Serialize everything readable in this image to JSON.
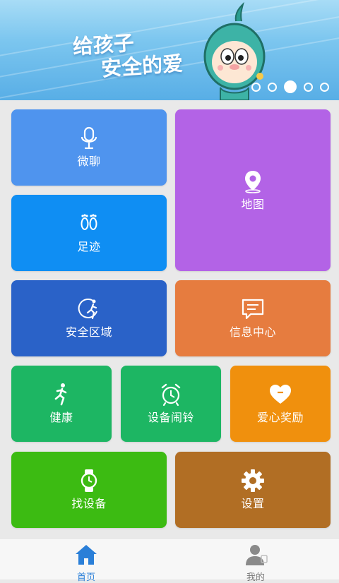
{
  "banner": {
    "slogan_line1": "给孩子",
    "slogan_line2": "安全的爱",
    "carousel_pages": 5,
    "active_page": 3
  },
  "tiles": {
    "chat": {
      "label": "微聊",
      "icon": "microphone-icon",
      "color": "#4f94ee"
    },
    "map": {
      "label": "地图",
      "icon": "map-pin-icon",
      "color": "#b363e6"
    },
    "footprint": {
      "label": "足迹",
      "icon": "footprints-icon",
      "color": "#0f8ef3"
    },
    "safe_zone": {
      "label": "安全区域",
      "icon": "running-circle-icon",
      "color": "#2a62c8"
    },
    "messages": {
      "label": "信息中心",
      "icon": "message-icon",
      "color": "#e67c3f"
    },
    "health": {
      "label": "健康",
      "icon": "runner-icon",
      "color": "#1db663"
    },
    "alarm": {
      "label": "设备闹铃",
      "icon": "alarm-clock-icon",
      "color": "#1db663"
    },
    "reward": {
      "label": "爱心奖励",
      "icon": "heart-icon",
      "color": "#f0900d"
    },
    "find_device": {
      "label": "找设备",
      "icon": "watch-icon",
      "color": "#3cbb12"
    },
    "settings": {
      "label": "设置",
      "icon": "gear-icon",
      "color": "#b16e24"
    }
  },
  "bottom_nav": {
    "home": {
      "label": "首页",
      "icon": "home-icon",
      "active": true,
      "color": "#2a7fd8"
    },
    "mine": {
      "label": "我的",
      "icon": "user-icon",
      "active": false,
      "color": "#777777"
    }
  }
}
